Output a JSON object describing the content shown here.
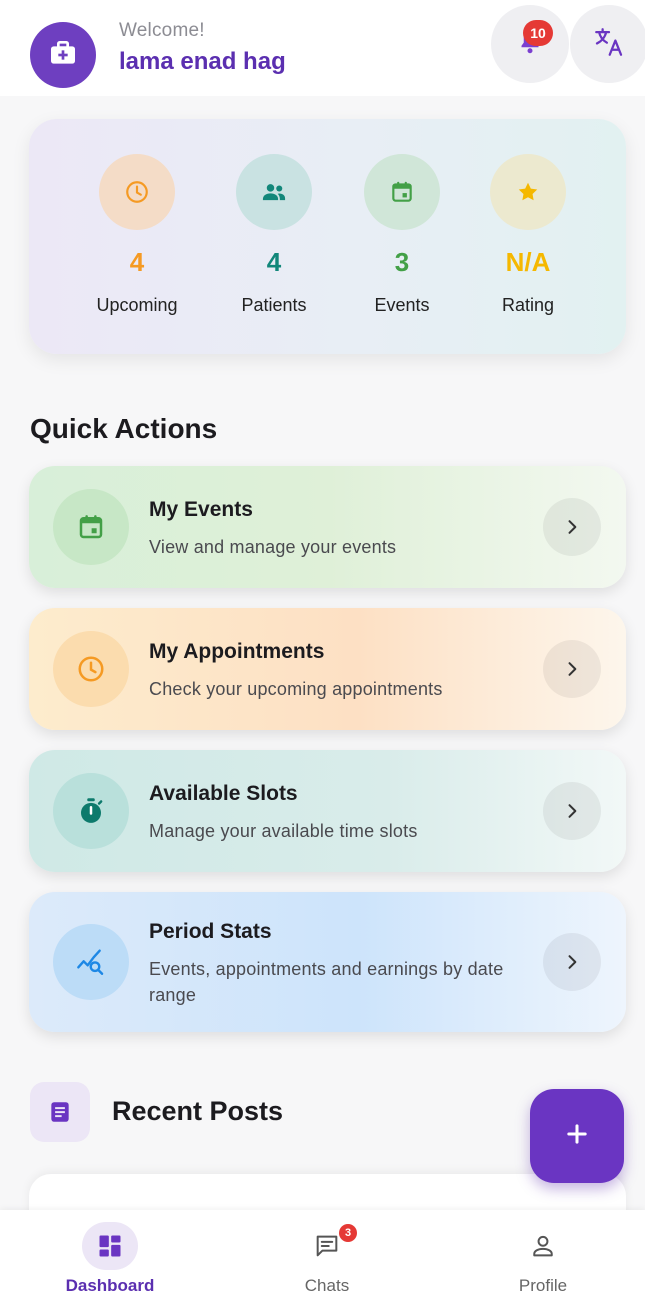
{
  "header": {
    "welcome": "Welcome!",
    "username": "lama enad hag",
    "notification_count": "10",
    "avatar_icon": "medical-kit-icon",
    "bell_icon": "bell-icon",
    "translate_icon": "translate-icon"
  },
  "stats": [
    {
      "value": "4",
      "label": "Upcoming",
      "icon": "clock-icon",
      "color": "#f59a23"
    },
    {
      "value": "4",
      "label": "Patients",
      "icon": "people-icon",
      "color": "#12877a"
    },
    {
      "value": "3",
      "label": "Events",
      "icon": "calendar-icon",
      "color": "#43a047"
    },
    {
      "value": "N/A",
      "label": "Rating",
      "icon": "star-icon",
      "color": "#f5b800"
    }
  ],
  "quick_actions": {
    "title": "Quick Actions",
    "items": [
      {
        "title": "My Events",
        "subtitle": "View and manage your events",
        "icon": "calendar-icon"
      },
      {
        "title": "My Appointments",
        "subtitle": "Check your upcoming appointments",
        "icon": "clock-icon"
      },
      {
        "title": "Available Slots",
        "subtitle": "Manage your available time slots",
        "icon": "stopwatch-icon"
      },
      {
        "title": "Period Stats",
        "subtitle": "Events, appointments and earnings by date range",
        "icon": "chart-search-icon"
      }
    ]
  },
  "recent_posts": {
    "title": "Recent Posts",
    "icon": "article-icon"
  },
  "fab": {
    "icon": "plus-icon"
  },
  "bottom_nav": {
    "items": [
      {
        "label": "Dashboard",
        "icon": "dashboard-icon",
        "active": true
      },
      {
        "label": "Chats",
        "icon": "chat-icon",
        "badge": "3"
      },
      {
        "label": "Profile",
        "icon": "person-icon"
      }
    ]
  },
  "colors": {
    "primary": "#6a35c2",
    "badge": "#e53935"
  }
}
